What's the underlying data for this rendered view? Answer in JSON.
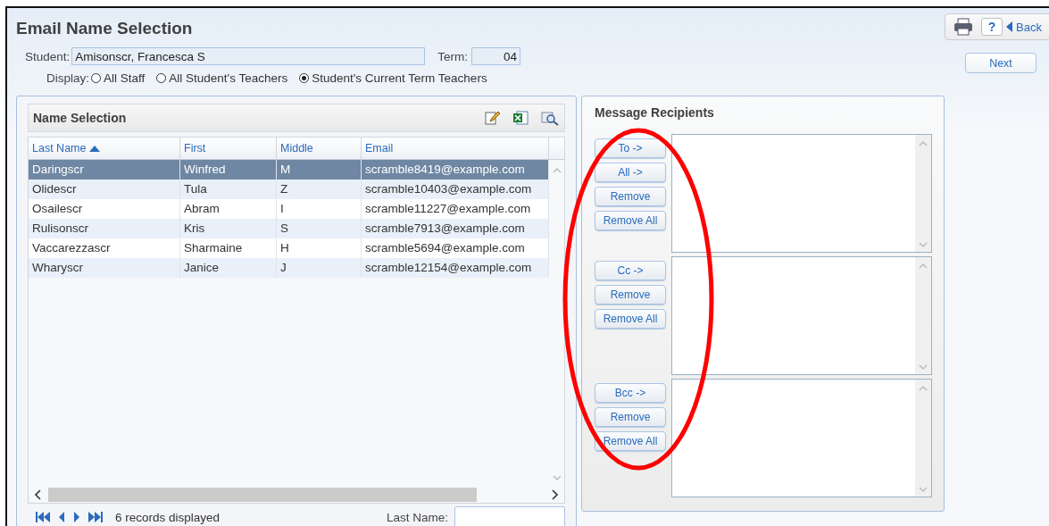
{
  "title": "Email Name Selection",
  "toolbar": {
    "help": "?",
    "back": "Back"
  },
  "next_button": "Next",
  "student": {
    "label": "Student:",
    "value": "Amisonscr, Francesca S"
  },
  "term": {
    "label": "Term:",
    "value": "04"
  },
  "display": {
    "label": "Display:",
    "options": [
      {
        "label": "All Staff",
        "selected": false
      },
      {
        "label": "All Student's Teachers",
        "selected": false
      },
      {
        "label": "Student's Current Term Teachers",
        "selected": true
      }
    ]
  },
  "name_selection": {
    "title": "Name Selection",
    "columns": [
      {
        "label": "Last Name",
        "sorted": true
      },
      {
        "label": "First",
        "sorted": false
      },
      {
        "label": "Middle",
        "sorted": false
      },
      {
        "label": "Email",
        "sorted": false
      }
    ],
    "rows": [
      {
        "cells": [
          "Daringscr",
          "Winfred",
          "M",
          "scramble8419@example.com"
        ],
        "selected": true
      },
      {
        "cells": [
          "Olidescr",
          "Tula",
          "Z",
          "scramble10403@example.com"
        ],
        "selected": false
      },
      {
        "cells": [
          "Osailescr",
          "Abram",
          "I",
          "scramble11227@example.com"
        ],
        "selected": false
      },
      {
        "cells": [
          "Rulisonscr",
          "Kris",
          "S",
          "scramble7913@example.com"
        ],
        "selected": false
      },
      {
        "cells": [
          "Vaccarezzascr",
          "Sharmaine",
          "H",
          "scramble5694@example.com"
        ],
        "selected": false
      },
      {
        "cells": [
          "Wharyscr",
          "Janice",
          "J",
          "scramble12154@example.com"
        ],
        "selected": false
      }
    ],
    "status": "6 records displayed",
    "search_label": "Last Name:"
  },
  "recipients": {
    "title": "Message Recipients",
    "groups": [
      {
        "buttons": [
          "To ->",
          "All ->",
          "Remove",
          "Remove All"
        ]
      },
      {
        "buttons": [
          "Cc ->",
          "Remove",
          "Remove All"
        ]
      },
      {
        "buttons": [
          "Bcc ->",
          "Remove",
          "Remove All"
        ]
      }
    ]
  }
}
